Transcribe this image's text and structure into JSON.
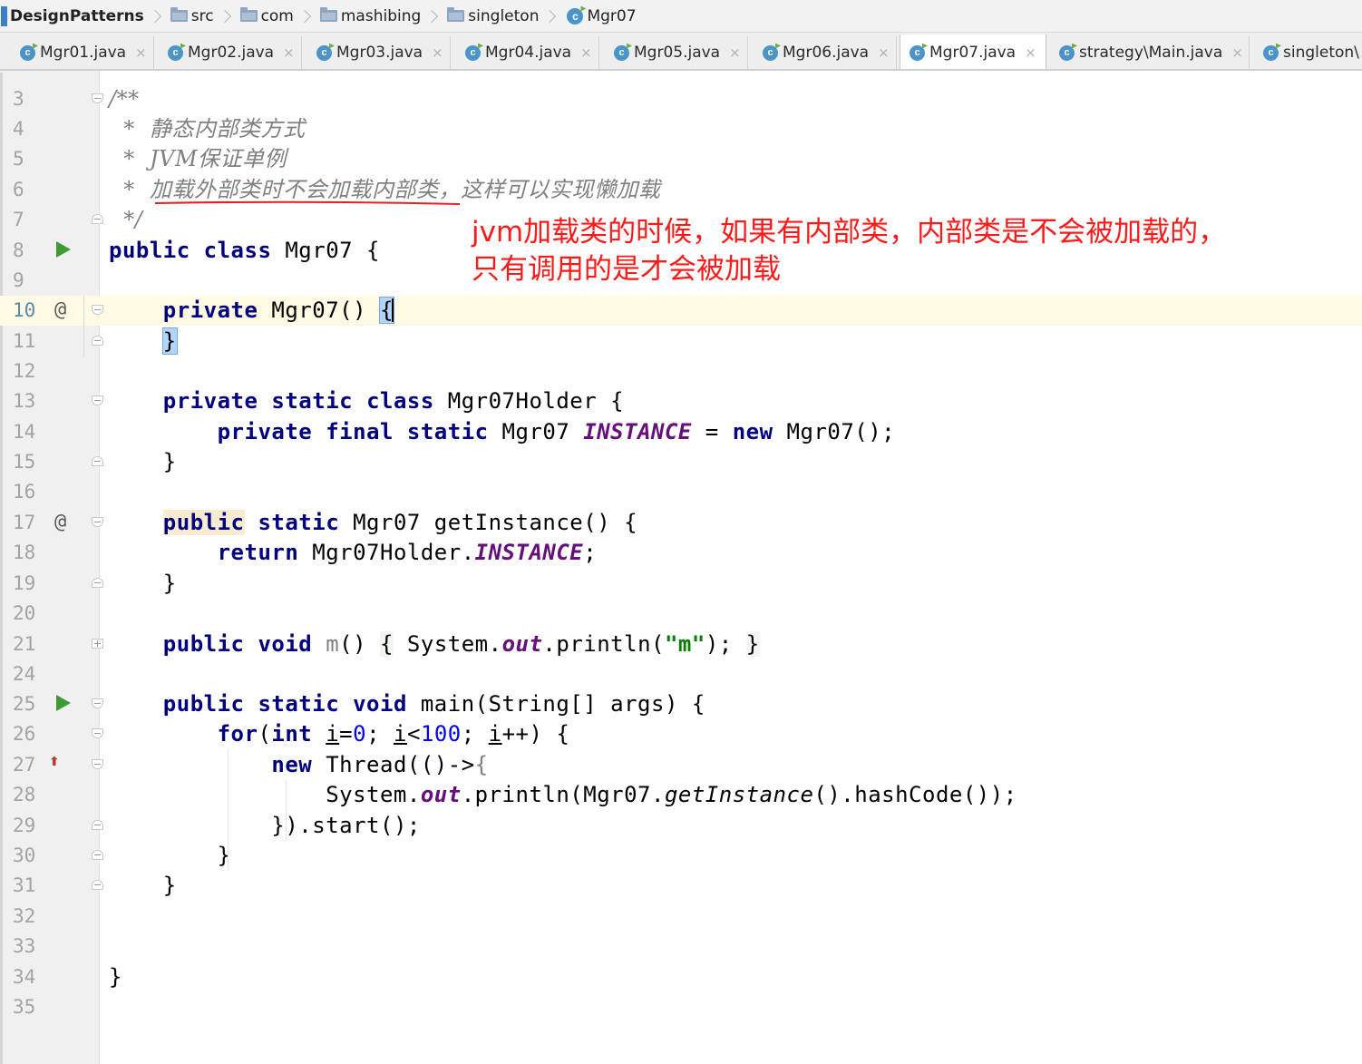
{
  "breadcrumb": [
    {
      "label": "DesignPatterns",
      "icon": "project-icon"
    },
    {
      "label": "src",
      "icon": "folder-icon"
    },
    {
      "label": "com",
      "icon": "folder-icon"
    },
    {
      "label": "mashibing",
      "icon": "folder-icon"
    },
    {
      "label": "singleton",
      "icon": "folder-icon"
    },
    {
      "label": "Mgr07",
      "icon": "class-icon"
    }
  ],
  "tabs": [
    {
      "label": "Mgr01.java",
      "active": false
    },
    {
      "label": "Mgr02.java",
      "active": false
    },
    {
      "label": "Mgr03.java",
      "active": false
    },
    {
      "label": "Mgr04.java",
      "active": false
    },
    {
      "label": "Mgr05.java",
      "active": false
    },
    {
      "label": "Mgr06.java",
      "active": false
    },
    {
      "label": "Mgr07.java",
      "active": true
    },
    {
      "label": "strategy\\Main.java",
      "active": false
    },
    {
      "label": "singleton\\",
      "active": false
    }
  ],
  "tab_close_glyph": "×",
  "class_icon_glyph": "c",
  "code": {
    "l3": {
      "num": "3",
      "t": [
        "/**"
      ]
    },
    "l4": {
      "num": "4",
      "t": [
        "  *  ",
        "静态内部类方式"
      ]
    },
    "l5": {
      "num": "5",
      "t": [
        "  *  ",
        "JVM保证单例"
      ]
    },
    "l6": {
      "num": "6",
      "t": [
        "  *  ",
        "加载外部类时不会加载内部类，这样可以实现懒加载"
      ]
    },
    "l7": {
      "num": "7",
      "t": [
        "  */"
      ]
    },
    "l8": {
      "num": "8",
      "t": [
        "public",
        " ",
        "class",
        " Mgr07 {"
      ]
    },
    "l9": {
      "num": "9"
    },
    "l10": {
      "num": "10",
      "t": [
        "    ",
        "private",
        " Mgr07() ",
        "{"
      ]
    },
    "l11": {
      "num": "11",
      "t": [
        "    ",
        "}"
      ]
    },
    "l12": {
      "num": "12"
    },
    "l13": {
      "num": "13",
      "t": [
        "    ",
        "private",
        " ",
        "static",
        " ",
        "class",
        " Mgr07Holder {"
      ]
    },
    "l14": {
      "num": "14",
      "t": [
        "        ",
        "private",
        " ",
        "final",
        " ",
        "static",
        " Mgr07 ",
        "INSTANCE",
        " = ",
        "new",
        " Mgr07();"
      ]
    },
    "l15": {
      "num": "15",
      "t": [
        "    }"
      ]
    },
    "l16": {
      "num": "16"
    },
    "l17": {
      "num": "17",
      "t": [
        "    ",
        "public",
        " ",
        "static",
        " Mgr07 getInstance() {"
      ]
    },
    "l18": {
      "num": "18",
      "t": [
        "        ",
        "return",
        " Mgr07Holder.",
        "INSTANCE",
        ";"
      ]
    },
    "l19": {
      "num": "19",
      "t": [
        "    }"
      ]
    },
    "l20": {
      "num": "20"
    },
    "l21": {
      "num": "21",
      "t": [
        "    ",
        "public",
        " ",
        "void",
        " ",
        "m",
        "() ",
        "{",
        " System.",
        "out",
        ".println(",
        "\"m\"",
        ");",
        " ",
        "}"
      ]
    },
    "l24": {
      "num": "24"
    },
    "l25": {
      "num": "25",
      "t": [
        "    ",
        "public",
        " ",
        "static",
        " ",
        "void",
        " main(String[] args) {"
      ]
    },
    "l26": {
      "num": "26",
      "t": [
        "        ",
        "for",
        "(",
        "int",
        " ",
        "i",
        "=",
        "0",
        "; ",
        "i",
        "<",
        "100",
        "; ",
        "i",
        "++) {"
      ]
    },
    "l27": {
      "num": "27",
      "t": [
        "            ",
        "new",
        " Thread(()->",
        "{"
      ]
    },
    "l28": {
      "num": "28",
      "t": [
        "                System.",
        "out",
        ".println(Mgr07.",
        "getInstance",
        "().hashCode());"
      ]
    },
    "l29": {
      "num": "29",
      "t": [
        "            ",
        "}",
        ").start();"
      ]
    },
    "l30": {
      "num": "30",
      "t": [
        "        }"
      ]
    },
    "l31": {
      "num": "31",
      "t": [
        "    }"
      ]
    },
    "l32": {
      "num": "32"
    },
    "l33": {
      "num": "33"
    },
    "l34": {
      "num": "34",
      "t": [
        "}"
      ]
    },
    "l35": {
      "num": "35"
    }
  },
  "annotation": {
    "line1": "jvm加载类的时候，如果有内部类，内部类是不会被加载的，",
    "line2": "只有调用的是才会被加载",
    "color": "#ff1a1a"
  },
  "gutter_glyphs": {
    "override": "@",
    "implemented": "⬆"
  },
  "colors": {
    "keyword": "#000080",
    "field": "#660e7a",
    "number": "#0000ff",
    "string": "#008000",
    "comment": "#808080",
    "current_line": "#fffae3"
  }
}
